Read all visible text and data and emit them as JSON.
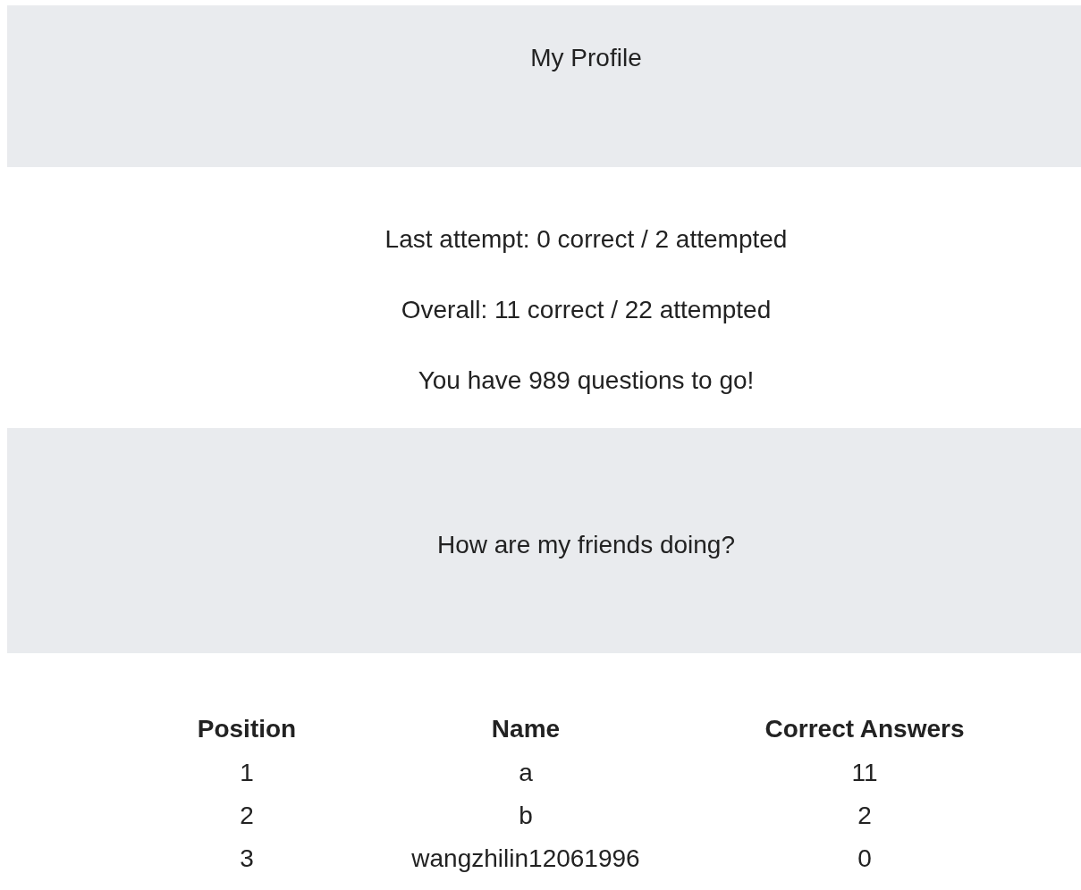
{
  "profile_header": {
    "title": "My Profile"
  },
  "stats": [
    "Last attempt: 0 correct / 2 attempted",
    "Overall: 11 correct / 22 attempted",
    "You have 989 questions to go!"
  ],
  "friends_header": {
    "title": "How are my friends doing?"
  },
  "table": {
    "columns": [
      "Position",
      "Name",
      "Correct Answers"
    ],
    "rows": [
      [
        "1",
        "a",
        "11"
      ],
      [
        "2",
        "b",
        "2"
      ],
      [
        "3",
        "wangzhilin12061996",
        "0"
      ]
    ]
  }
}
